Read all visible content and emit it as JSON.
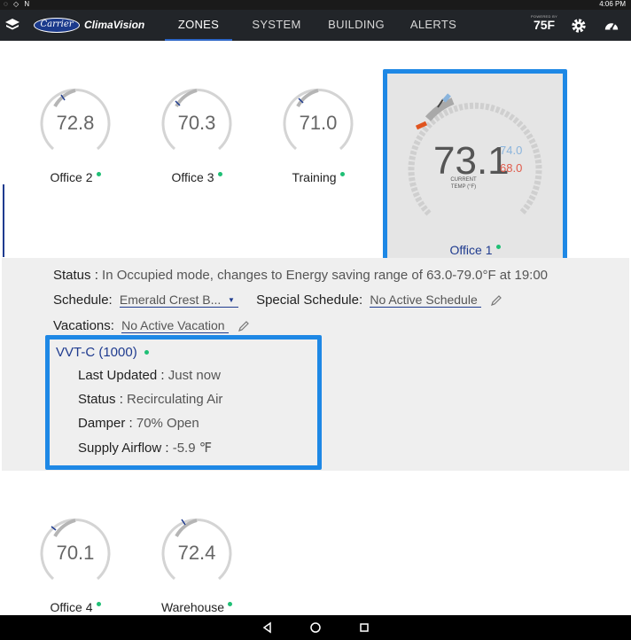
{
  "statusbar": {
    "left_icons": "◌ ◇ N",
    "time": "4:06 PM"
  },
  "appbar": {
    "brand": "Carrier",
    "app_name": "ClimaVision",
    "tabs": [
      {
        "label": "ZONES",
        "active": true
      },
      {
        "label": "SYSTEM",
        "active": false
      },
      {
        "label": "BUILDING",
        "active": false
      },
      {
        "label": "ALERTS",
        "active": false
      }
    ],
    "powered_by": "POWERED BY",
    "powered_logo": "75F"
  },
  "zones": [
    {
      "name": "Office 2",
      "temp": "72.8"
    },
    {
      "name": "Office 3",
      "temp": "70.3"
    },
    {
      "name": "Training",
      "temp": "71.0"
    },
    {
      "name": "Office 4",
      "temp": "70.1"
    },
    {
      "name": "Warehouse",
      "temp": "72.4"
    }
  ],
  "selected_zone": {
    "name": "Office 1",
    "current_temp": "73.1",
    "cooling_setpoint": "74.0",
    "heating_setpoint": "68.0",
    "label_line1": "CURRENT",
    "label_line2": "TEMP (°F)"
  },
  "details": {
    "status_label": "Status :",
    "status_value": "In Occupied mode, changes to Energy saving range of 63.0-79.0°F at 19:00",
    "schedule_label": "Schedule:",
    "schedule_value": "Emerald Crest B...",
    "special_schedule_label": "Special Schedule:",
    "special_schedule_value": "No Active Schedule",
    "vacations_label": "Vacations:",
    "vacations_value": "No Active Vacation"
  },
  "vvt": {
    "title": "VVT-C (1000)",
    "last_updated_label": "Last Updated :",
    "last_updated_value": "Just now",
    "status_label": "Status :",
    "status_value": "Recirculating Air",
    "damper_label": "Damper :",
    "damper_value": "70% Open",
    "airflow_label": "Supply Airflow :",
    "airflow_value": "-5.9 ℉"
  },
  "colors": {
    "accent": "#1e88e5",
    "online": "#1fbf75",
    "navy": "#1f3b8f",
    "appbar": "#222529"
  }
}
